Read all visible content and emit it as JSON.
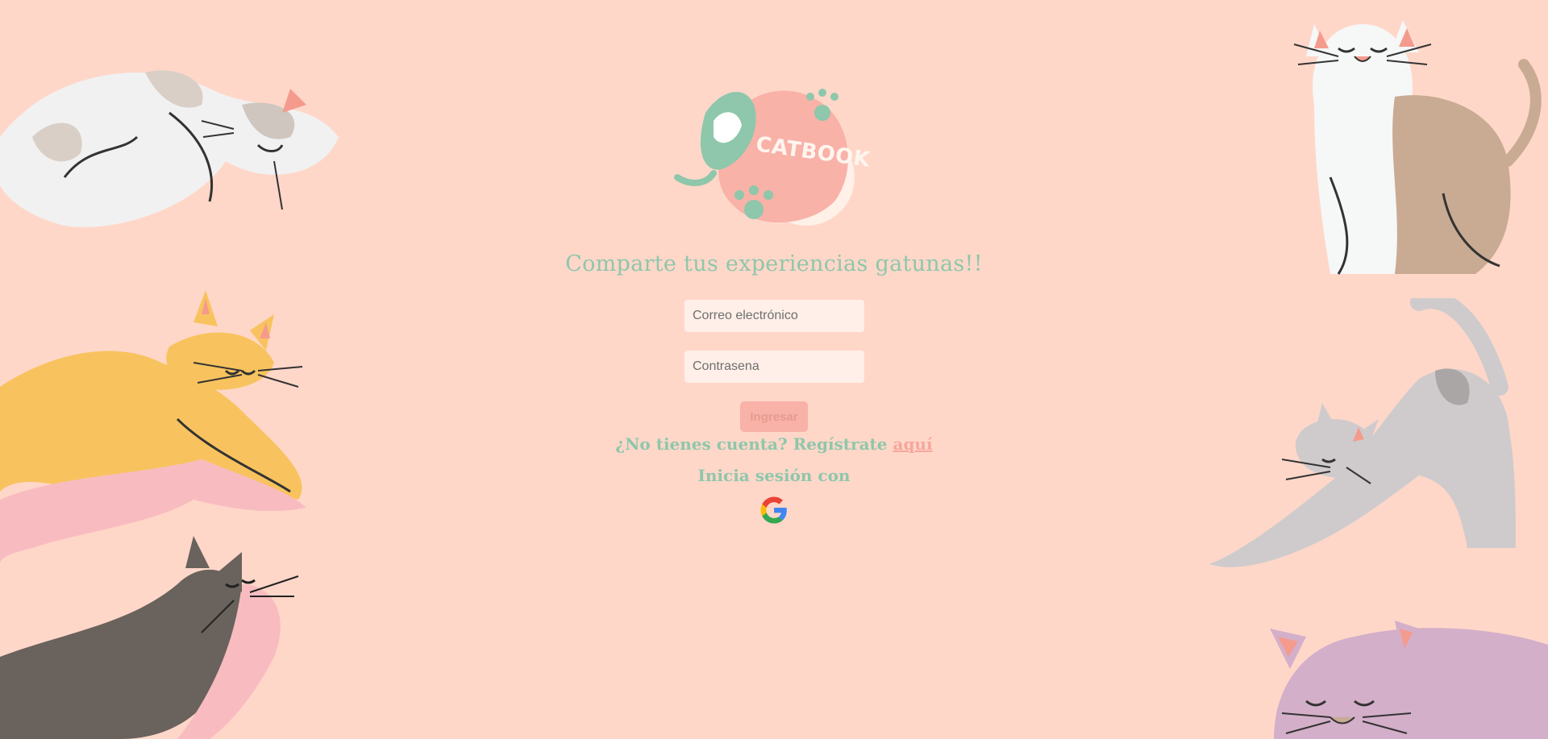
{
  "brand": {
    "logo_text": "CATBOOK"
  },
  "headline": "Comparte tus experiencias gatunas!!",
  "form": {
    "email_placeholder": "Correo electrónico",
    "password_placeholder": "Contrasena",
    "submit_label": "Ingresar"
  },
  "signup": {
    "prompt": "¿No tienes cuenta? Regístrate",
    "link_text": "aquí"
  },
  "social": {
    "label": "Inicia sesión con",
    "google_icon": "google-icon"
  },
  "colors": {
    "background": "#ffd7c9",
    "accent_green": "#8ec7ab",
    "accent_pink": "#f8b2a8",
    "field_bg": "#ffefe8"
  }
}
